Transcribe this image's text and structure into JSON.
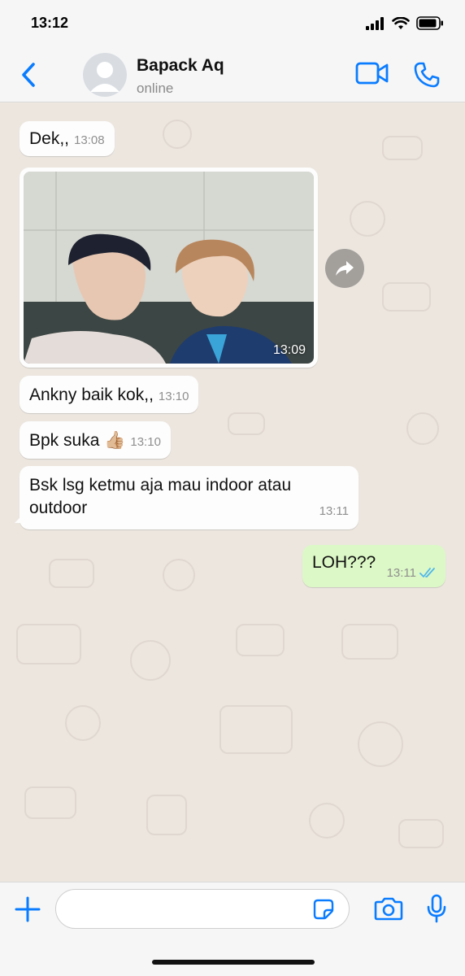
{
  "status_bar": {
    "time": "13:12"
  },
  "header": {
    "contact_name": "Bapack Aq",
    "contact_status": "online"
  },
  "messages": [
    {
      "direction": "in",
      "type": "text",
      "text": "Dek,,",
      "time": "13:08"
    },
    {
      "direction": "in",
      "type": "image",
      "time": "13:09",
      "image_alt": "photo of two people"
    },
    {
      "direction": "in",
      "type": "text",
      "text": "Ankny baik kok,,",
      "time": "13:10"
    },
    {
      "direction": "in",
      "type": "text",
      "text": "Bpk suka 👍🏼",
      "time": "13:10"
    },
    {
      "direction": "in",
      "type": "text",
      "text": "Bsk lsg ketmu aja mau indoor atau outdoor",
      "time": "13:11"
    },
    {
      "direction": "out",
      "type": "text",
      "text": "LOH???",
      "time": "13:11",
      "status": "read"
    }
  ],
  "input": {
    "placeholder": ""
  },
  "colors": {
    "accent": "#0a7cff",
    "outgoing_bubble": "#dcf8c6",
    "incoming_bubble": "#fdfdfd",
    "chat_background": "#ece6df",
    "read_ticks": "#4fb6ec"
  },
  "icons": [
    "back-chevron-icon",
    "avatar-placeholder-icon",
    "video-call-icon",
    "phone-icon",
    "forward-icon",
    "plus-icon",
    "sticker-icon",
    "camera-icon",
    "microphone-icon",
    "double-check-icon"
  ]
}
